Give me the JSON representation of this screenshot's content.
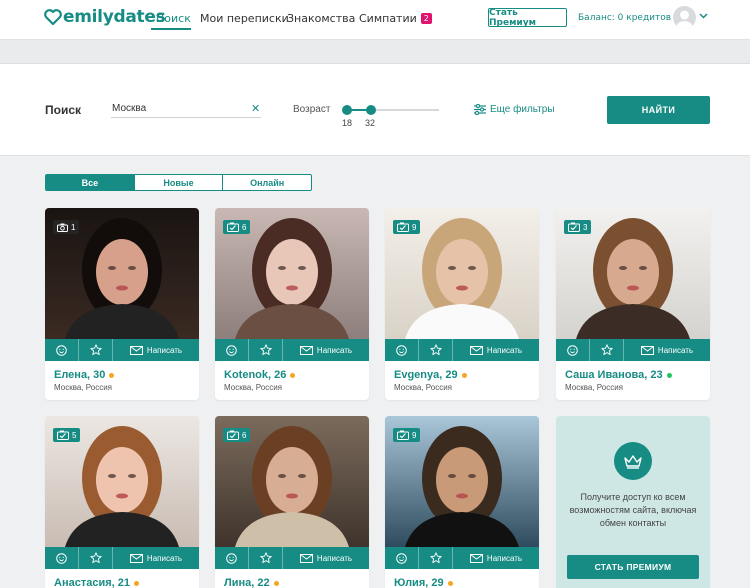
{
  "header": {
    "logo": "emilydates",
    "nav": [
      "Поиск",
      "Мои переписки",
      "Знакомства",
      "Симпатии"
    ],
    "likes_badge": "2",
    "premium_button": "Стать Премиум",
    "balance": "Баланс: 0 кредитов"
  },
  "search": {
    "label": "Поиск",
    "city_value": "Москва",
    "age_label": "Возраст",
    "age_min": "18",
    "age_max": "32",
    "more_filters": "Еще фильтры",
    "find_button": "НАЙТИ"
  },
  "tabs": [
    "Все",
    "Новые",
    "Онлайн"
  ],
  "card_actions": {
    "write": "Написать"
  },
  "colors": {
    "accent": "#178c84",
    "online": "#22c55e",
    "away": "#f5a623",
    "badge": "#e2136e"
  },
  "profiles": [
    {
      "name": "Елена, 30",
      "location": "Москва, Россия",
      "photos": "1",
      "status": "away",
      "icon": "camera-icon"
    },
    {
      "name": "Kotenok, 26",
      "location": "Москва, Россия",
      "photos": "6",
      "status": "away",
      "icon": "photos-icon"
    },
    {
      "name": "Evgenya, 29",
      "location": "Москва, Россия",
      "photos": "9",
      "status": "away",
      "icon": "photos-icon"
    },
    {
      "name": "Саша Иванова, 23",
      "location": "Москва, Россия",
      "photos": "3",
      "status": "online",
      "icon": "photos-icon"
    },
    {
      "name": "Анастасия, 21",
      "location": "",
      "photos": "5",
      "status": "away",
      "icon": "photos-icon"
    },
    {
      "name": "Лина, 22",
      "location": "",
      "photos": "6",
      "status": "away",
      "icon": "photos-icon"
    },
    {
      "name": "Юлия, 29",
      "location": "",
      "photos": "9",
      "status": "away",
      "icon": "photos-icon"
    }
  ],
  "promo": {
    "text": "Получите доступ ко всем возможностям сайта, включая обмен контакты",
    "button": "СТАТЬ ПРЕМИУМ",
    "icon": "crown-icon"
  }
}
